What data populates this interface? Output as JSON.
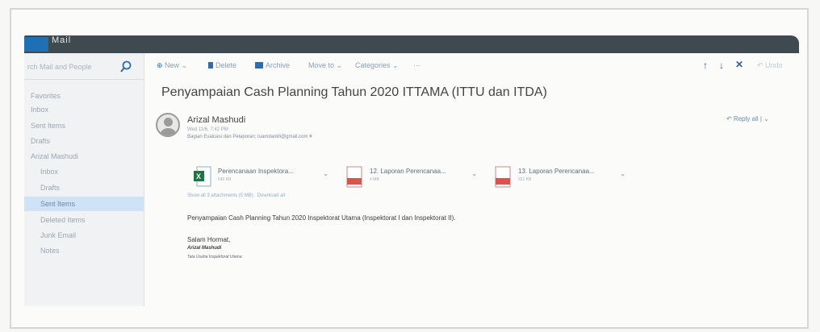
{
  "app": {
    "title": "Mail"
  },
  "search": {
    "placeholder": "rch Mail and People"
  },
  "sidebar": {
    "items": [
      {
        "label": "Favorites"
      },
      {
        "label": "Inbox"
      },
      {
        "label": "Sent Items"
      },
      {
        "label": "Drafts"
      },
      {
        "label": "Arizal Mashudi"
      },
      {
        "label": "Inbox"
      },
      {
        "label": "Drafts"
      },
      {
        "label": "Sent Items"
      },
      {
        "label": "Deleted Items"
      },
      {
        "label": "Junk Email"
      },
      {
        "label": "Notes"
      }
    ],
    "active_index": 7
  },
  "toolbar": {
    "new_label": "New",
    "delete_label": "Delete",
    "archive_label": "Archive",
    "move_label": "Move to",
    "categories_label": "Categories",
    "more_label": "···",
    "up_icon": "↑",
    "down_icon": "↓",
    "close_icon": "✕",
    "undo_label": "Undo"
  },
  "message": {
    "subject": "Penyampaian Cash Planning Tahun 2020 ITTAMA (ITTU dan ITDA)",
    "sender": "Arizal Mashudi",
    "date": "Wed 11/6, 7:42 PM",
    "to": "Bagian Evaluasi dan Pelaporan; tuamdankli@gmail.com",
    "reply_all_label": "Reply all",
    "attachments": [
      {
        "name": "Perencanaan Inspektora...",
        "size": "545 KB",
        "type": "excel"
      },
      {
        "name": "12. Laporan Perencanaa...",
        "size": "4 MB",
        "type": "pdf"
      },
      {
        "name": "13. Laporan Perencanaa...",
        "size": "321 KB",
        "type": "pdf"
      }
    ],
    "show_all_label": "Show all 3 attachments (5 MB)",
    "download_all_label": "Download all",
    "body_line1": "Penyampaian Cash Planning Tahun 2020 Inspektorat Utama (Inspektorat I dan Inspektorat II).",
    "greeting": "Salam Hormat,",
    "signature_name": "Arizal Mashudi",
    "signature_title": "Tata Usaha Inspektorat Utama"
  },
  "colors": {
    "accent": "#0078d7",
    "topbar": "#3f4a50",
    "active_folder": "#cfe2f6",
    "excel": "#217346",
    "pdf": "#d9534f"
  }
}
